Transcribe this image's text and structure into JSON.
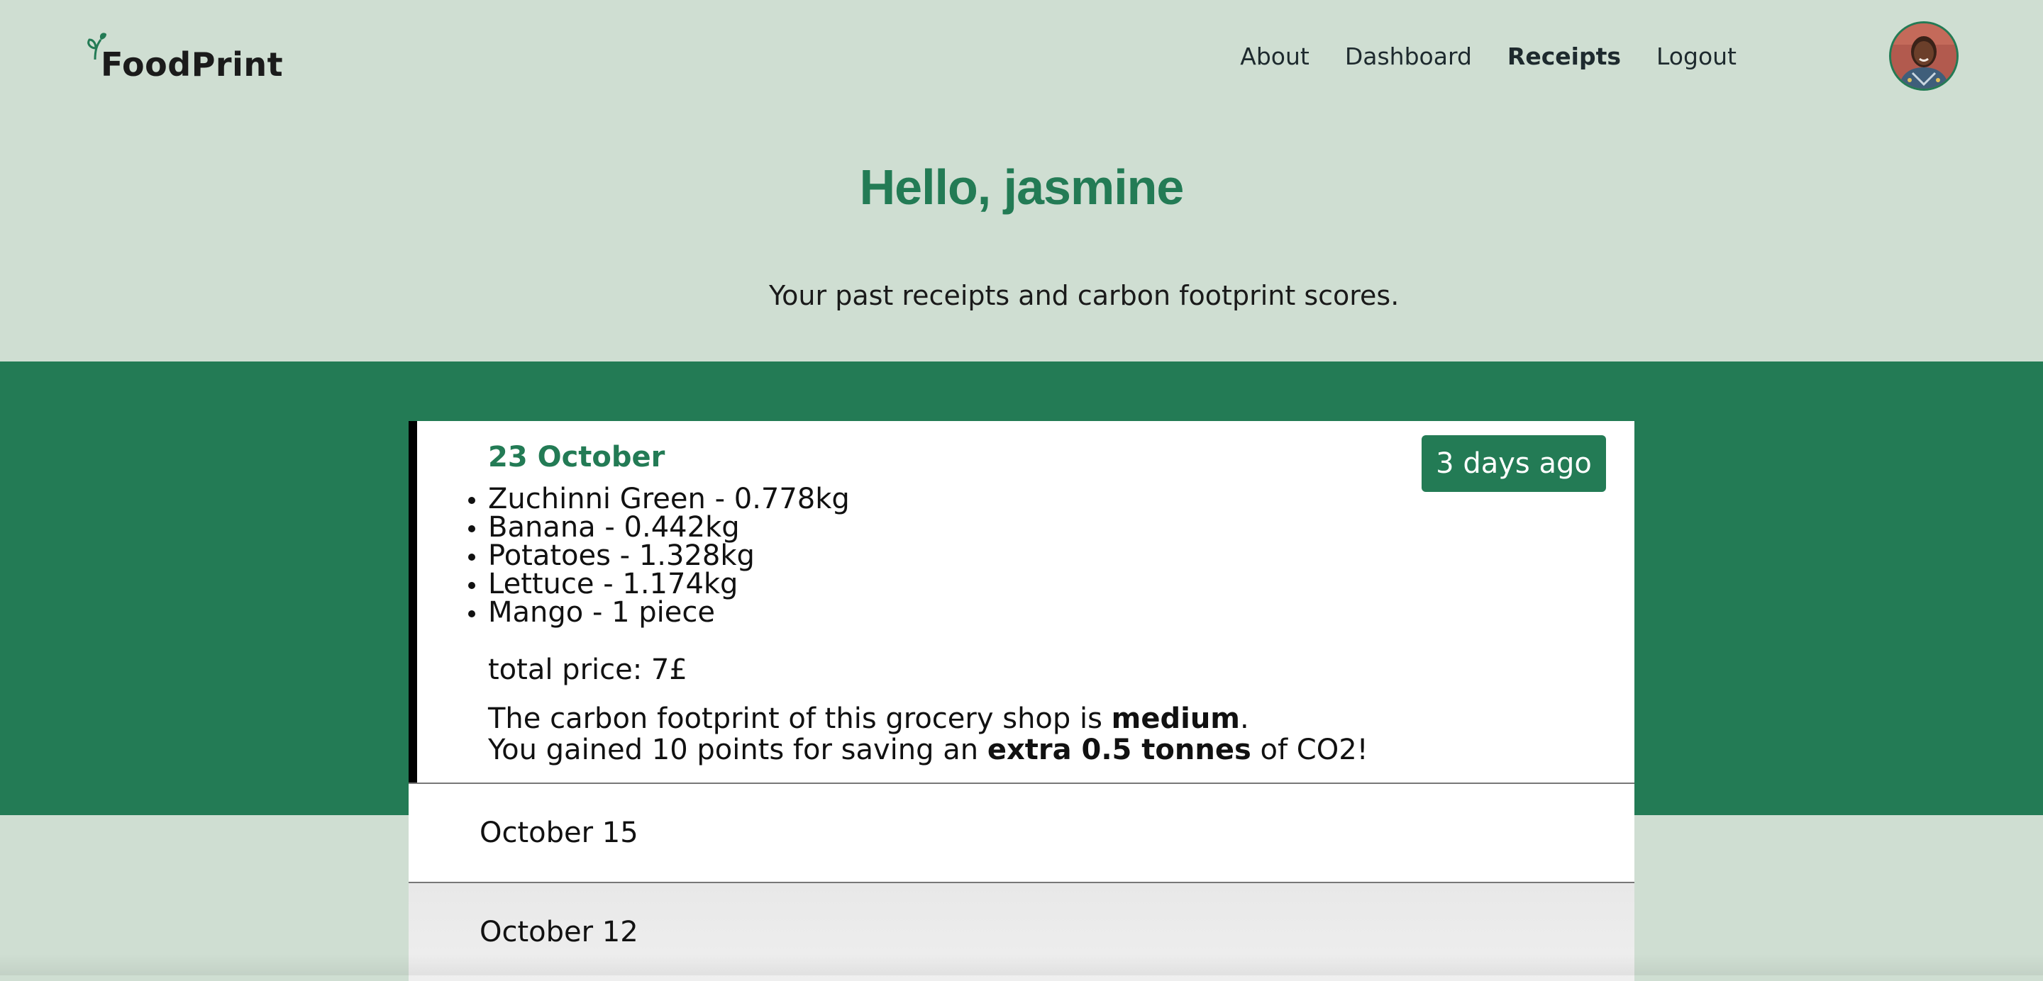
{
  "brand": {
    "name": "FoodPrint",
    "accent_color": "#237b55",
    "background_color": "#cfded2"
  },
  "nav": {
    "items": [
      {
        "label": "About",
        "active": false
      },
      {
        "label": "Dashboard",
        "active": false
      },
      {
        "label": "Receipts",
        "active": true
      },
      {
        "label": "Logout",
        "active": false
      }
    ],
    "avatar_icon": "user-avatar"
  },
  "hero": {
    "greeting": "Hello, jasmine",
    "subtitle": "Your past receipts and carbon footprint scores."
  },
  "receipts": {
    "open": {
      "date": "23 October",
      "age_badge": "3 days ago",
      "items": [
        "Zuchinni Green - 0.778kg",
        "Banana - 0.442kg",
        "Potatoes - 1.328kg",
        "Lettuce - 1.174kg",
        "Mango - 1 piece"
      ],
      "price_text": "total price: 7£",
      "footprint_prefix": "The carbon footprint of this grocery shop is ",
      "footprint_level": "medium",
      "footprint_suffix": ".",
      "points_prefix": "You gained 10 points for saving an ",
      "points_bold": "extra 0.5 tonnes",
      "points_suffix": " of CO2!"
    },
    "collapsed": [
      {
        "date": "October 15"
      },
      {
        "date": "October 12"
      }
    ]
  }
}
